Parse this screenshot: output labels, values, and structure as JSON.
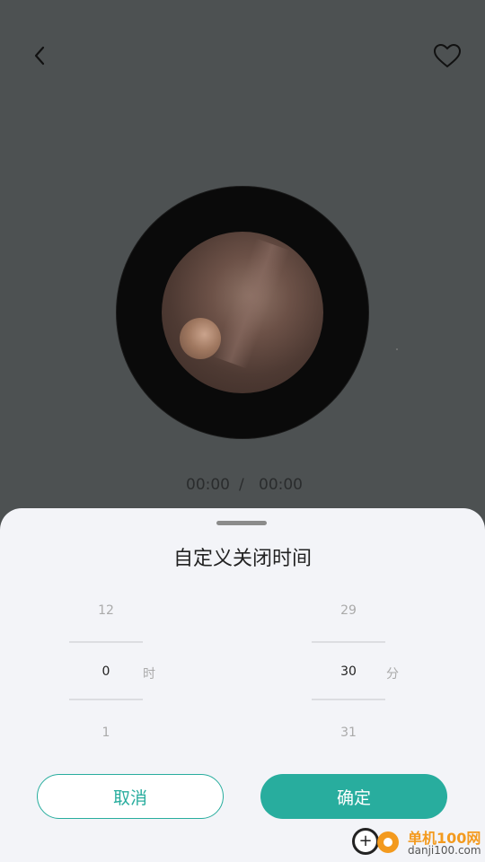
{
  "player": {
    "current_time": "00:00",
    "separator": "/",
    "total_time": "00:00"
  },
  "timer_sheet": {
    "title": "自定义关闭时间",
    "hours": {
      "prev": "12",
      "selected": "0",
      "next": "1",
      "unit": "时"
    },
    "minutes": {
      "prev": "29",
      "selected": "30",
      "next": "31",
      "unit": "分"
    },
    "cancel_label": "取消",
    "confirm_label": "确定"
  },
  "watermark": {
    "title": "单机100网",
    "url": "danji100.com"
  },
  "colors": {
    "accent": "#28ad9e",
    "background_dim": "#4d5152",
    "sheet_bg": "#f3f4f8"
  },
  "icons": [
    "back-icon",
    "heart-icon"
  ]
}
